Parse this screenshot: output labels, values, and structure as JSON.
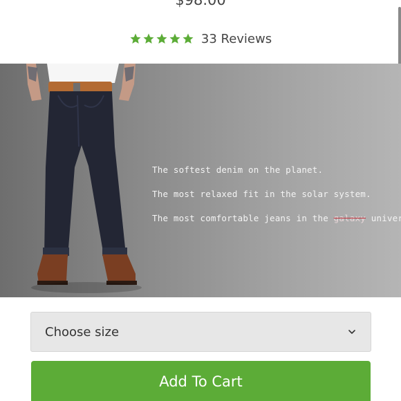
{
  "product": {
    "price": "$98.00",
    "rating": {
      "stars": 5,
      "reviews_label": "33 Reviews"
    }
  },
  "hero": {
    "taglines": [
      {
        "text": "The softest denim on the planet."
      },
      {
        "text": "The most relaxed fit in the solar system."
      },
      {
        "prefix": "The most comfortable jeans in the ",
        "struck": "galaxy",
        "suffix": " universe."
      }
    ]
  },
  "size_select": {
    "selected": "Choose size"
  },
  "cart": {
    "button_label": "Add To Cart"
  },
  "colors": {
    "accent": "#5cac37",
    "star": "#5cac37",
    "strike": "#c0303a"
  },
  "icons": {
    "star": "star-icon",
    "chevron": "chevron-down-icon"
  }
}
